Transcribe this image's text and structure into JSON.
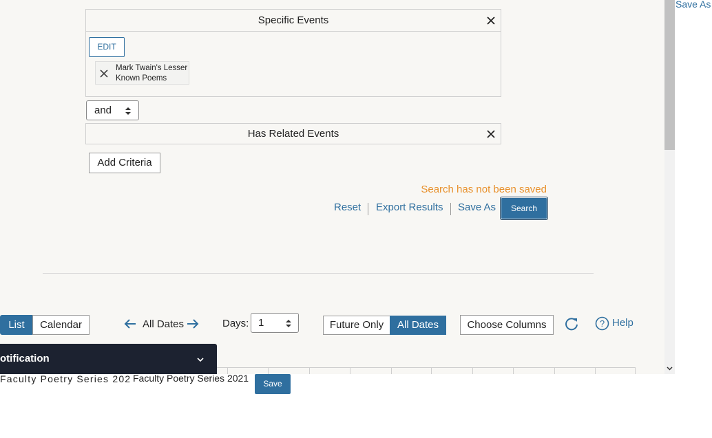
{
  "top_right": {
    "save_as_label": "Save As"
  },
  "specific_events": {
    "title": "Specific Events",
    "edit_label": "EDIT",
    "chip_label_line1": "Mark Twain's Lesser",
    "chip_label_line2": "Known Poems"
  },
  "conjunction": {
    "value": "and"
  },
  "related_events": {
    "title": "Has Related Events"
  },
  "add_criteria_label": "Add Criteria",
  "search_status": "Search has not been saved",
  "actions": {
    "reset": "Reset",
    "export": "Export Results",
    "save_as": "Save As",
    "search": "Search"
  },
  "view_toolbar": {
    "list": "List",
    "calendar": "Calendar",
    "date_range": "All Dates",
    "days_label": "Days:",
    "days_value": "1",
    "future_only": "Future Only",
    "all_dates": "All Dates",
    "choose_columns": "Choose Columns",
    "help": "Help"
  },
  "notification": {
    "title": "otification"
  },
  "bottom": {
    "garbled_text": "Faculty Poetry Series 202",
    "text": "Faculty Poetry Series 2021",
    "save_label": "Save"
  },
  "colors": {
    "accent": "#2f6f9f",
    "warning": "#e8912d",
    "notification_bg": "#1c2230",
    "canvas_bg": "#f8f7f4"
  }
}
